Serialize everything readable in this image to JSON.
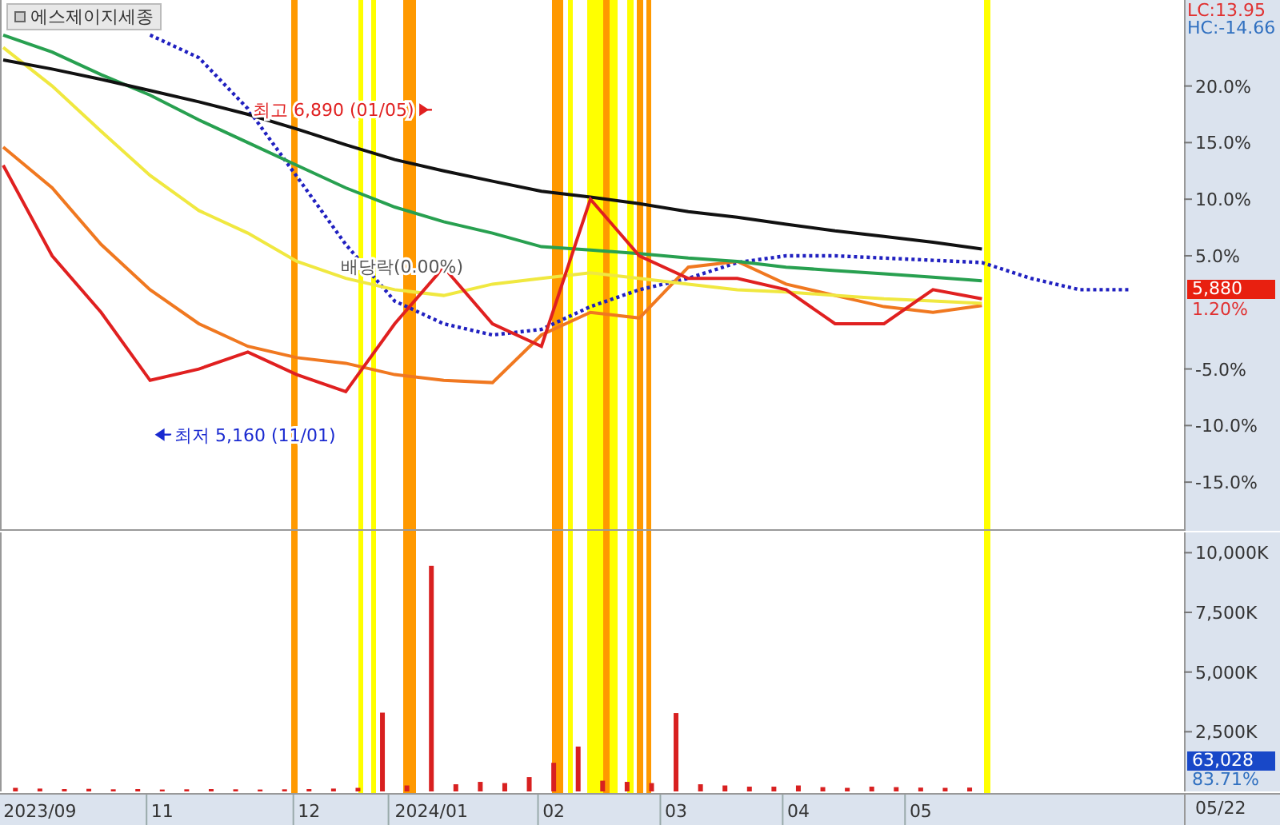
{
  "title": "에스제이지세종",
  "price_chart": {
    "lc": "LC:13.95",
    "hc": "HC:-14.66",
    "price_tag": "5,880",
    "change_tag": "1.20%",
    "labels": [
      {
        "kind": "high",
        "text": "최고 6,890 (01/05)"
      },
      {
        "kind": "low",
        "text": "최저 5,160 (11/01)"
      },
      {
        "kind": "dividend",
        "text": "배당락(0.00%)"
      }
    ],
    "chart_data": {
      "type": "line",
      "categories": [
        null,
        null,
        null,
        null,
        null,
        null,
        null,
        null,
        null,
        null,
        null,
        null,
        null,
        null,
        null,
        null,
        null,
        null,
        null,
        null,
        null,
        null,
        null,
        null
      ],
      "ylim": [
        -19.3,
        27.6
      ],
      "yticks": [
        {
          "value": 20,
          "label": "20.0%"
        },
        {
          "value": 15,
          "label": "15.0%"
        },
        {
          "value": 10,
          "label": "10.0%"
        },
        {
          "value": 5,
          "label": "5.0%"
        },
        {
          "value": -5,
          "label": "-5.0%"
        },
        {
          "value": -10,
          "label": "-10.0%"
        },
        {
          "value": -15,
          "label": "-15.0%"
        }
      ],
      "series": [
        {
          "color": "#e02020",
          "values": [
            13,
            5,
            0,
            -6,
            -5,
            -3.5,
            -5.5,
            -7,
            -1,
            4,
            -1,
            -3,
            10,
            5,
            3,
            3,
            2,
            -1,
            -1,
            2,
            1.2,
            null,
            null,
            null
          ]
        },
        {
          "color": "#111111",
          "values": [
            22.3,
            21.5,
            20.6,
            19.6,
            18.6,
            17.5,
            16.2,
            14.8,
            13.5,
            12.5,
            11.6,
            10.7,
            10.2,
            9.6,
            8.9,
            8.4,
            7.8,
            7.2,
            6.7,
            6.2,
            5.6,
            null,
            null,
            null
          ]
        },
        {
          "color": "#28a050",
          "values": [
            24.5,
            23,
            21,
            19.2,
            17,
            15,
            13,
            11,
            9.3,
            8,
            7,
            5.8,
            5.5,
            5.2,
            4.8,
            4.5,
            4,
            3.7,
            3.4,
            3.1,
            2.8,
            null,
            null,
            null
          ]
        },
        {
          "color": "#f0e840",
          "values": [
            23.4,
            20,
            16,
            12.1,
            9,
            7,
            4.5,
            3,
            2,
            1.5,
            2.5,
            3,
            3.5,
            3,
            2.5,
            2,
            1.8,
            1.5,
            1.2,
            1,
            0.8,
            null,
            null,
            null
          ]
        },
        {
          "color": "#f07820",
          "values": [
            14.6,
            11,
            6,
            2,
            -1,
            -3,
            -4,
            -4.5,
            -5.5,
            -6,
            -6.2,
            -2,
            0,
            -0.5,
            4,
            4.5,
            2.5,
            1.5,
            0.5,
            0,
            0.6,
            null,
            null,
            null
          ]
        },
        {
          "color": "#2020c0",
          "line_style": "dotted",
          "values": [
            null,
            null,
            null,
            24.5,
            22.5,
            18,
            12,
            6,
            1,
            -1,
            -2,
            -1.5,
            0.5,
            2,
            3,
            4.4,
            5,
            5,
            4.8,
            4.6,
            4.4,
            3,
            2,
            2
          ]
        }
      ]
    }
  },
  "signals": [
    {
      "color": "#ff9900"
    },
    {
      "color": "#ffff00"
    },
    {
      "color": "#ffff00"
    },
    {
      "color": "#ff9900"
    },
    {
      "color": "#ff9900"
    },
    {
      "color": "#ffff00"
    },
    {
      "color": "#ffff00"
    },
    {
      "color": "#ff9900"
    },
    {
      "color": "#ffff00"
    },
    {
      "color": "#ff9900"
    },
    {
      "color": "#ff9900"
    },
    {
      "color": "#ffff00"
    }
  ],
  "volume_chart": {
    "volume_tag": "63,028",
    "ratio_tag": "83.71%",
    "chart_data": {
      "type": "bar",
      "categories": [
        null,
        "2023/09",
        null,
        null,
        null,
        null,
        "11",
        null,
        null,
        null,
        null,
        null,
        "12",
        null,
        null,
        null,
        null,
        "2024/01",
        null,
        null,
        null,
        null,
        "02",
        null,
        null,
        null,
        null,
        "03",
        null,
        null,
        null,
        null,
        "04",
        null,
        null,
        null,
        null,
        "05",
        null,
        null,
        null,
        null,
        null,
        null,
        null,
        null,
        null,
        null
      ],
      "ylim": [
        0,
        10850
      ],
      "yticks": [
        {
          "value": 10000,
          "label": "10,000K"
        },
        {
          "value": 7500,
          "label": "7,500K"
        },
        {
          "value": 5000,
          "label": "5,000K"
        },
        {
          "value": 2500,
          "label": "2,500K"
        }
      ],
      "series": [
        {
          "color": "#d82020",
          "values": [
            150,
            120,
            100,
            110,
            90,
            100,
            80,
            90,
            100,
            90,
            80,
            90,
            100,
            120,
            150,
            3300,
            250,
            9450,
            300,
            400,
            350,
            600,
            1200,
            1880,
            450,
            400,
            350,
            3280,
            300,
            250,
            200,
            200,
            250,
            180,
            150,
            200,
            180,
            160,
            150,
            160,
            null,
            null,
            null,
            null,
            null,
            null,
            null,
            null
          ]
        }
      ]
    }
  },
  "x_axis": {
    "end_label": "05/22"
  }
}
